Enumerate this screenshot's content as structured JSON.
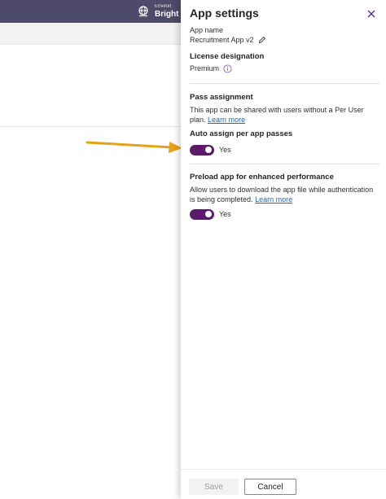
{
  "topbar": {
    "environment_label": "Environ",
    "environment_name": "Bright"
  },
  "panel": {
    "title": "App settings",
    "app_name_label": "App name",
    "app_name_value": "Recruitment App v2",
    "license_label": "License designation",
    "license_value": "Premium",
    "pass_assignment": {
      "heading": "Pass assignment",
      "description": "This app can be shared with users without a Per User plan.",
      "link": "Learn more",
      "toggle_heading": "Auto assign per app passes",
      "toggle_value": "Yes",
      "toggle_on": true
    },
    "preload": {
      "heading": "Preload app for enhanced performance",
      "description": "Allow users to download the app file while authentication is being completed.",
      "link": "Learn more",
      "toggle_value": "Yes",
      "toggle_on": true
    },
    "footer": {
      "save_label": "Save",
      "cancel_label": "Cancel"
    }
  },
  "colors": {
    "topbar": "#4e4a69",
    "toggle_on": "#5c1a6b",
    "link": "#0f6cbd",
    "close_icon": "#5c2d91",
    "annotation_arrow": "#e3a21a"
  },
  "icons": {
    "environment": "globe-building-icon",
    "close": "close-icon",
    "edit": "pencil-icon",
    "info": "info-icon"
  }
}
